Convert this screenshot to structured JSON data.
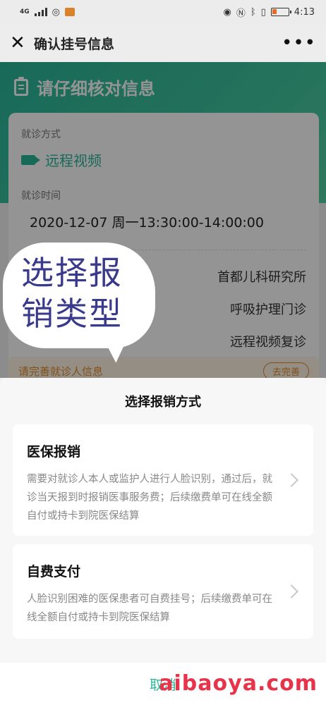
{
  "status_bar": {
    "network": "4G",
    "time": "4:13"
  },
  "title_bar": {
    "title": "确认挂号信息",
    "close_icon": "close-icon",
    "more_icon": "more-dots-icon"
  },
  "background_page": {
    "heading": "请仔细核对信息",
    "visit_mode_label": "就诊方式",
    "visit_mode_value": "远程视频",
    "visit_time_label": "就诊时间",
    "visit_time_value": "2020-12-07  周一13:30:00-14:00:00",
    "info_rows": [
      "首都儿科研究所",
      "呼吸护理门诊",
      "远程视频复诊"
    ],
    "notice_text": "请完善就诊人信息",
    "notice_button": "去完善"
  },
  "annotation": {
    "line1": "选择报",
    "line2": "销类型"
  },
  "sheet": {
    "title": "选择报销方式",
    "options": [
      {
        "title": "医保报销",
        "desc": "需要对就诊人本人或监护人进行人脸识别，通过后，就诊当天报到时报销医事服务费；后续缴费单可在线全额自付或持卡到院医保结算"
      },
      {
        "title": "自费支付",
        "desc": "人脸识别困难的医保患者可自费挂号；后续缴费单可在线全额自付或持卡到院医保结算"
      }
    ],
    "cancel": "取消"
  },
  "watermark": "aibaoya.com",
  "colors": {
    "accent": "#2bb69a",
    "watermark": "#e8344a",
    "annotation_text": "#3a3a8c"
  }
}
